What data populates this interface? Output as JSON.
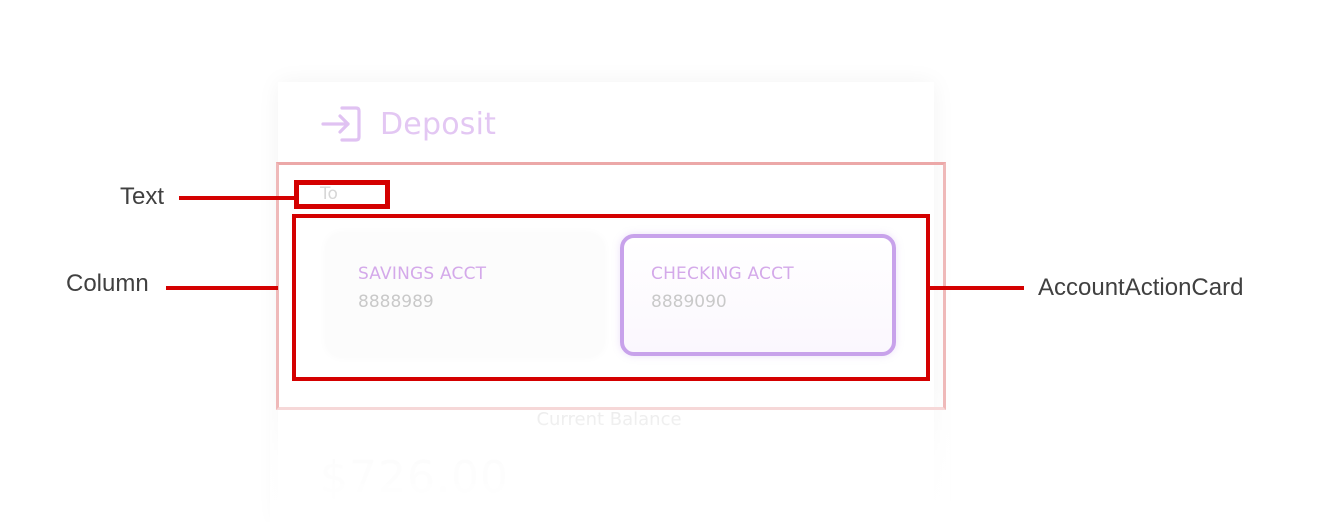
{
  "deposit": {
    "title": "Deposit",
    "icon": "sign-in-icon",
    "to_label": "To"
  },
  "accounts": [
    {
      "name": "SAVINGS ACCT",
      "number": "8888989",
      "selected": false
    },
    {
      "name": "CHECKING ACCT",
      "number": "8889090",
      "selected": true
    }
  ],
  "balance": {
    "label": "Current Balance",
    "amount": "$726.00"
  },
  "annotations": {
    "text": "Text",
    "column": "Column",
    "account_card": "AccountActionCard"
  },
  "colors": {
    "accent": "#c8a2eb",
    "annotation": "#d40000"
  }
}
